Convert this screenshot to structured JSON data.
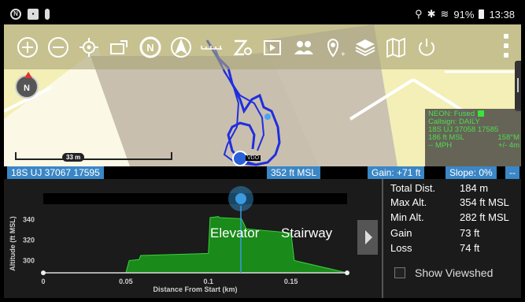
{
  "statusbar": {
    "left_icons": [
      "notification-icon",
      "photo-icon",
      "person-icon"
    ],
    "battery": "91%",
    "time": "13:38"
  },
  "toolbar": {
    "icons": [
      "zoom-in-icon",
      "zoom-out-icon",
      "locate-icon",
      "rotate-icon",
      "north-up-icon",
      "nav-icon",
      "measure-icon",
      "route-icon",
      "video-icon",
      "contacts-icon",
      "add-waypoint-icon",
      "layers-icon",
      "map-icon",
      "power-icon",
      "more-icon"
    ]
  },
  "map": {
    "compass_label": "N",
    "scale_label": "33 m",
    "vdo_label": "VDO",
    "info_panel": {
      "line1": "NEON: Fused",
      "line2": "Callsign: DAILY",
      "line3": "18S UJ 37058 17585",
      "line4_left": "186 ft MSL",
      "line4_right": "158°M",
      "line5_left": "-- MPH",
      "line5_right": "+/- 4m"
    }
  },
  "readout": {
    "grid": "18S UJ 37067 17595",
    "altitude": "352 ft MSL",
    "gain": "Gain: +71 ft",
    "slope": "Slope: 0%",
    "extra": "--"
  },
  "profile": {
    "chart_data": {
      "type": "area",
      "xlabel": "Distance From Start (km)",
      "ylabel": "Altitude (ft MSL)",
      "x_ticks": [
        "0",
        "0.05",
        "0.1",
        "0.15"
      ],
      "y_ticks": [
        "300",
        "320",
        "340"
      ],
      "xlim": [
        0,
        0.184
      ],
      "ylim": [
        288,
        352
      ],
      "x": [
        0.0,
        0.05,
        0.052,
        0.058,
        0.059,
        0.1,
        0.101,
        0.106,
        0.107,
        0.12,
        0.123,
        0.15,
        0.152,
        0.184
      ],
      "y": [
        283,
        287,
        300,
        301,
        305,
        307,
        342,
        343,
        342,
        341,
        331,
        327,
        300,
        282
      ],
      "annotations": [
        "Elevator",
        "Stairway"
      ],
      "colors": {
        "fill": "#1a8a1a",
        "line": "#3ad43a",
        "marker": "#3a9be0"
      }
    },
    "stats": {
      "total_dist_label": "Total Dist.",
      "total_dist": "184 m",
      "max_alt_label": "Max Alt.",
      "max_alt": "354 ft MSL",
      "min_alt_label": "Min Alt.",
      "min_alt": "282 ft MSL",
      "gain_label": "Gain",
      "gain": "73 ft",
      "loss_label": "Loss",
      "loss": "74 ft"
    },
    "viewshed_label": "Show Viewshed"
  }
}
